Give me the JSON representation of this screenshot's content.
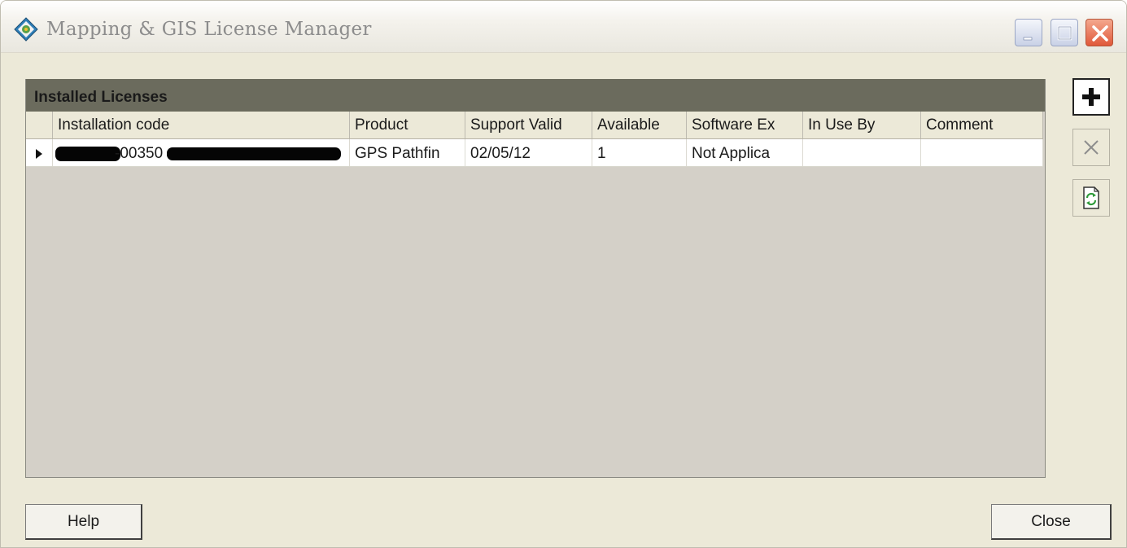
{
  "window": {
    "title": "Mapping & GIS License Manager"
  },
  "panel": {
    "title": "Installed Licenses",
    "columns": [
      "Installation code",
      "Product",
      "Support Valid",
      "Available",
      "Software Ex",
      "In Use By",
      "Comment"
    ],
    "rows": [
      {
        "installation_code_visible": "-00350",
        "product": "GPS Pathfin",
        "support_valid": "02/05/12",
        "available": "1",
        "software_ex": "Not Applica",
        "in_use_by": "",
        "comment": ""
      }
    ]
  },
  "side_buttons": {
    "add": "plus-icon",
    "remove": "x-icon",
    "refresh": "refresh-icon"
  },
  "buttons": {
    "help": "Help",
    "close": "Close"
  },
  "colors": {
    "panel_header": "#6b6b5d",
    "panel_body": "#d4d0c8",
    "window_bg": "#ece9d8",
    "close_button": "#e0583a"
  }
}
